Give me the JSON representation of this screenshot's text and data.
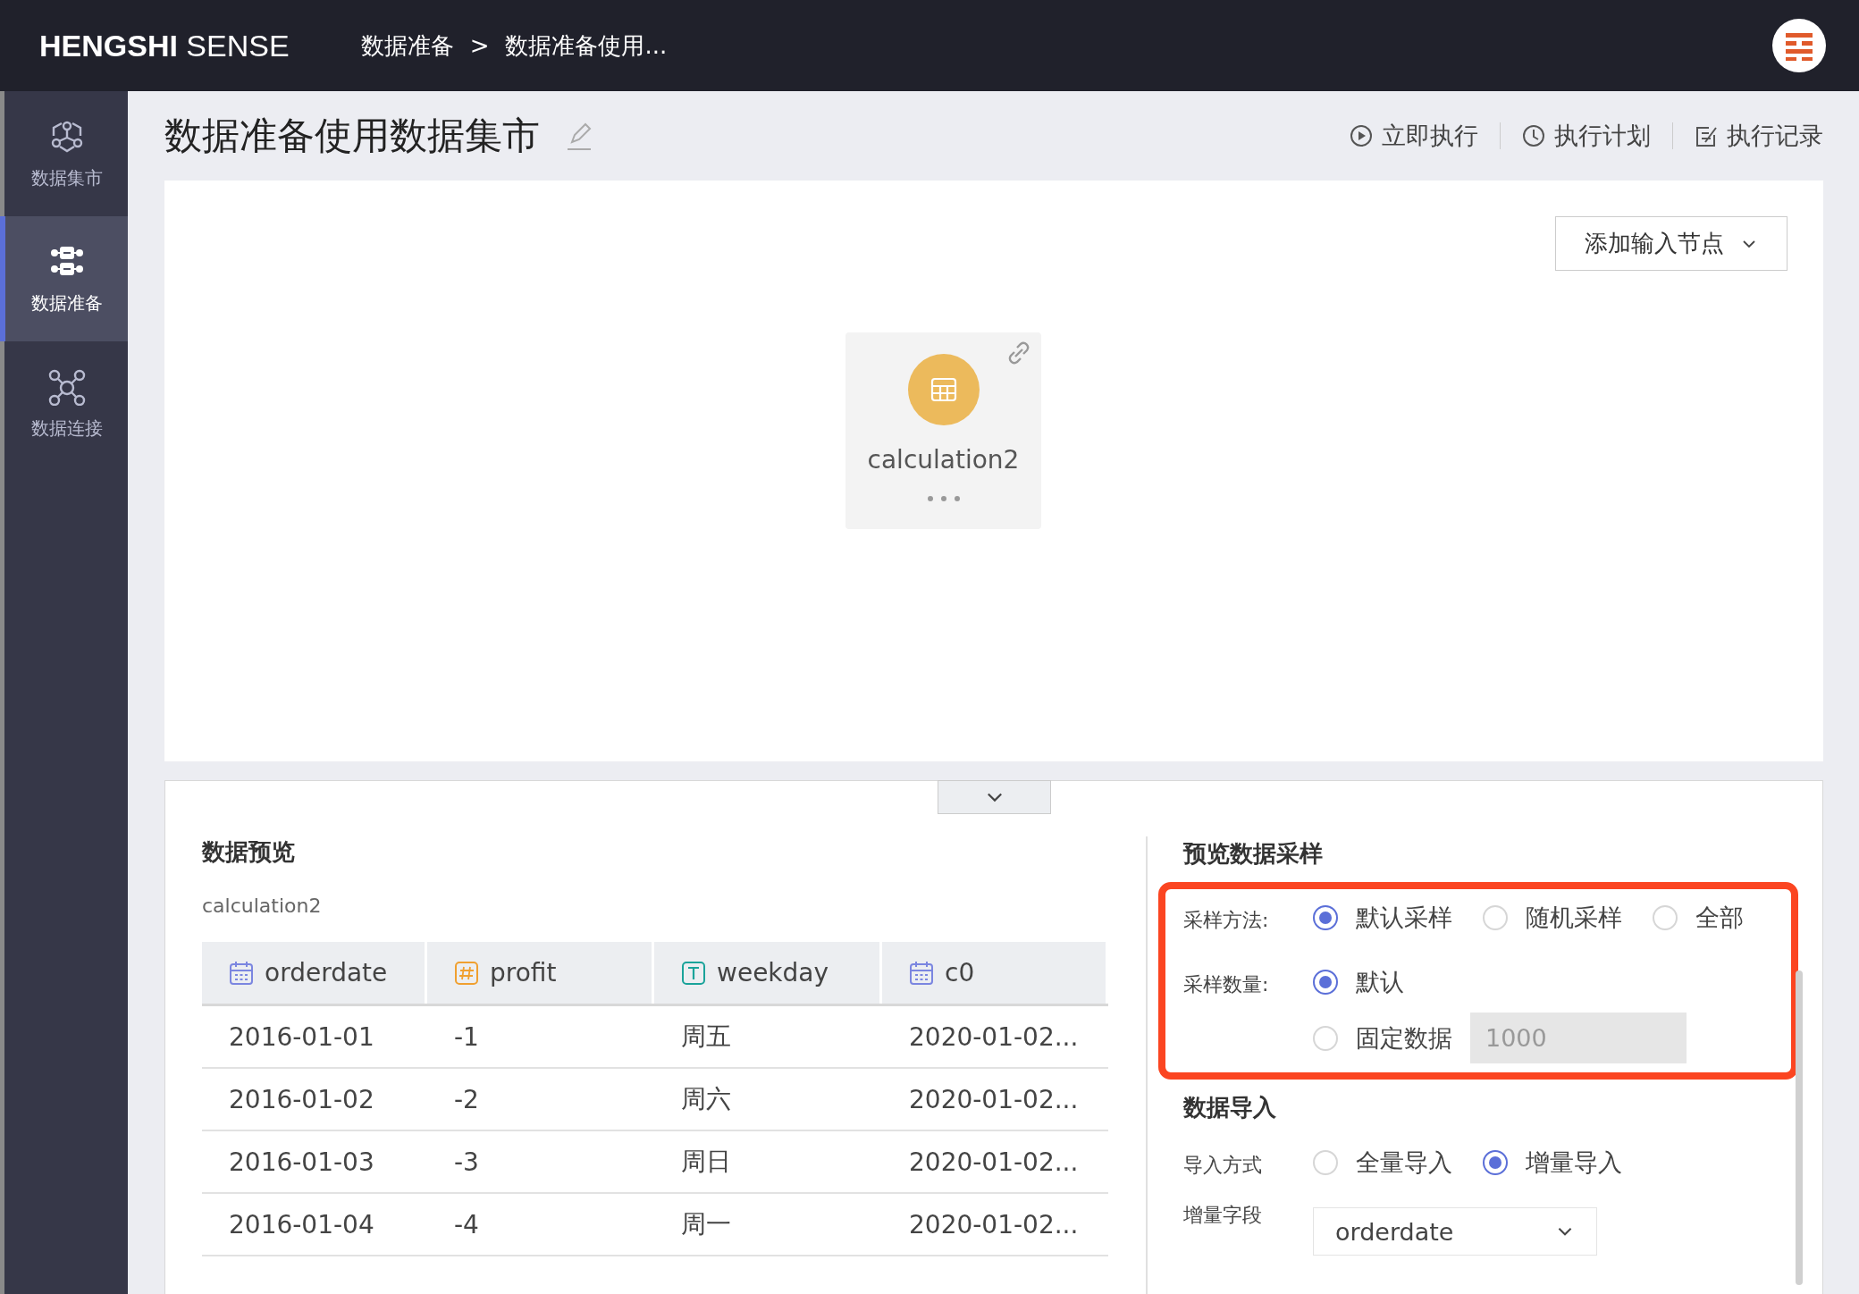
{
  "app": {
    "brand_bold": "HENGSHI",
    "brand_light": "SENSE",
    "breadcrumb": [
      "数据准备",
      "数据准备使用..."
    ],
    "separator": ">"
  },
  "sidebar": {
    "items": [
      {
        "label": "数据集市",
        "kind": "market",
        "selected": false
      },
      {
        "label": "数据准备",
        "kind": "prep",
        "selected": true
      },
      {
        "label": "数据连接",
        "kind": "connect",
        "selected": false
      }
    ]
  },
  "page": {
    "title": "数据准备使用数据集市",
    "actions": [
      {
        "label": "立即执行",
        "kind": "play"
      },
      {
        "label": "执行计划",
        "kind": "clock"
      },
      {
        "label": "执行记录",
        "kind": "log"
      }
    ]
  },
  "canvas": {
    "add_button": "添加输入节点",
    "nodes": [
      {
        "label": "calculation2"
      }
    ]
  },
  "preview": {
    "title": "数据预览",
    "source": "calculation2",
    "table": {
      "columns": [
        {
          "name": "orderdate",
          "kind": "date"
        },
        {
          "name": "profit",
          "kind": "number"
        },
        {
          "name": "weekday",
          "kind": "text"
        },
        {
          "name": "c0",
          "kind": "date"
        }
      ],
      "rows": [
        [
          "2016-01-01",
          "-1",
          "周五",
          "2020-01-02..."
        ],
        [
          "2016-01-02",
          "-2",
          "周六",
          "2020-01-02..."
        ],
        [
          "2016-01-03",
          "-3",
          "周日",
          "2020-01-02..."
        ],
        [
          "2016-01-04",
          "-4",
          "周一",
          "2020-01-02..."
        ]
      ]
    }
  },
  "sampling": {
    "title": "预览数据采样",
    "highlighted": true,
    "method": {
      "label": "采样方法:",
      "options": [
        {
          "label": "默认采样",
          "selected": true
        },
        {
          "label": "随机采样",
          "selected": false
        },
        {
          "label": "全部",
          "selected": false
        }
      ]
    },
    "count": {
      "label": "采样数量:",
      "options": [
        {
          "label": "默认",
          "selected": true
        },
        {
          "label": "固定数据",
          "selected": false,
          "value": "1000",
          "disabled": true
        }
      ]
    }
  },
  "import": {
    "title": "数据导入",
    "mode": {
      "label": "导入方式",
      "options": [
        {
          "label": "全量导入",
          "selected": false
        },
        {
          "label": "增量导入",
          "selected": true
        }
      ]
    },
    "field": {
      "label": "增量字段",
      "value": "orderdate"
    }
  }
}
